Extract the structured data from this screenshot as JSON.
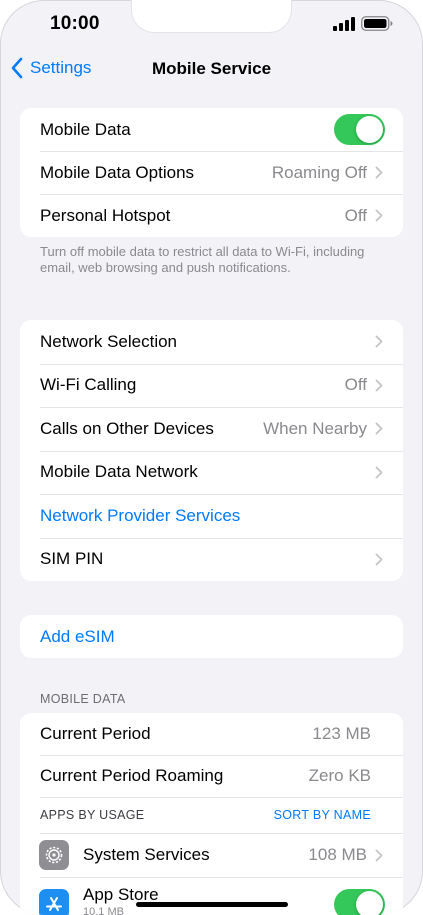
{
  "status_bar": {
    "time": "10:00"
  },
  "nav": {
    "back_label": "Settings",
    "title": "Mobile Service"
  },
  "group1": {
    "rows": [
      {
        "label": "Mobile Data",
        "toggle": true
      },
      {
        "label": "Mobile Data Options",
        "value": "Roaming Off"
      },
      {
        "label": "Personal Hotspot",
        "value": "Off"
      }
    ],
    "footer": "Turn off mobile data to restrict all data to Wi-Fi, including email, web browsing and push notifications."
  },
  "group2": {
    "rows": [
      {
        "label": "Network Selection"
      },
      {
        "label": "Wi-Fi Calling",
        "value": "Off"
      },
      {
        "label": "Calls on Other Devices",
        "value": "When Nearby"
      },
      {
        "label": "Mobile Data Network"
      },
      {
        "label": "Network Provider Services"
      },
      {
        "label": "SIM PIN"
      }
    ]
  },
  "group3": {
    "add_esim": "Add eSIM"
  },
  "mobile_data_section": {
    "header": "MOBILE DATA",
    "rows": [
      {
        "label": "Current Period",
        "value": "123 MB"
      },
      {
        "label": "Current Period Roaming",
        "value": "Zero KB"
      }
    ],
    "apps_by_usage": "APPS BY USAGE",
    "sort_label": "SORT BY NAME",
    "apps": [
      {
        "name": "System Services",
        "value": "108 MB",
        "icon": "gear-icon"
      },
      {
        "name": "App Store",
        "sub": "10.1 MB",
        "icon": "app-store-icon",
        "toggle": true
      }
    ]
  },
  "colors": {
    "accent": "#007aff",
    "toggle_on": "#34c759",
    "background": "#f2f2f7"
  }
}
